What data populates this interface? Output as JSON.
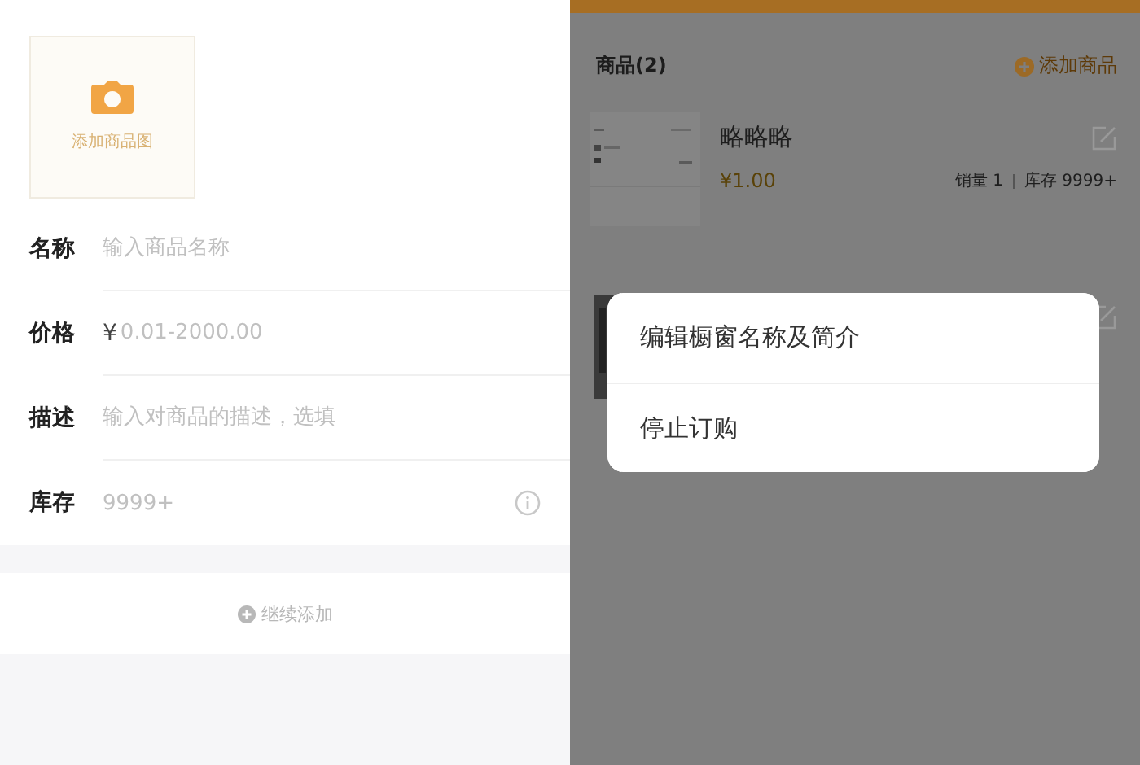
{
  "form": {
    "upload": {
      "label": "添加商品图"
    },
    "fields": [
      {
        "label": "名称",
        "placeholder": "输入商品名称",
        "kind": "text"
      },
      {
        "label": "价格",
        "prefix": "¥",
        "placeholder": "0.01-2000.00",
        "kind": "text"
      },
      {
        "label": "描述",
        "placeholder": "输入对商品的描述，选填",
        "kind": "text"
      },
      {
        "label": "库存",
        "placeholder": "9999+",
        "kind": "info"
      }
    ],
    "add_more": "继续添加"
  },
  "list": {
    "title": "商品(2)",
    "add_button": "添加商品",
    "products": [
      {
        "kind": "full",
        "name": "略略略",
        "price": "¥1.00",
        "sales": "销量 1",
        "stock": "库存 9999+"
      },
      {
        "kind": "covered"
      }
    ]
  },
  "menu": {
    "items": [
      "编辑橱窗名称及简介",
      "停止订购"
    ]
  }
}
